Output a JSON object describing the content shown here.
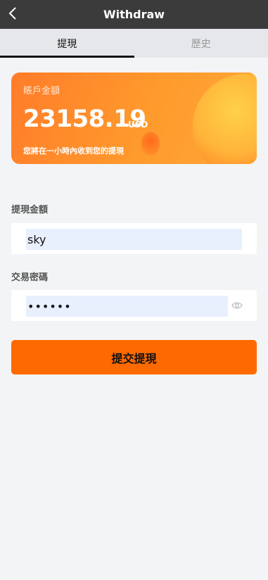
{
  "header": {
    "title": "Withdraw"
  },
  "tabs": [
    {
      "label": "提現",
      "active": true
    },
    {
      "label": "歷史",
      "active": false
    }
  ],
  "balance_card": {
    "label": "賬戶金額",
    "amount": "23158.19",
    "currency": "USD",
    "note": "您將在一小時內收到您的提現"
  },
  "form": {
    "amount_label": "提現金額",
    "amount_value": "sky",
    "password_label": "交易密碼",
    "password_value": "••••••",
    "submit_label": "提交提現"
  },
  "colors": {
    "accent": "#ff6a00",
    "topbar": "#3b3b3b",
    "background": "#f3f4f6"
  }
}
